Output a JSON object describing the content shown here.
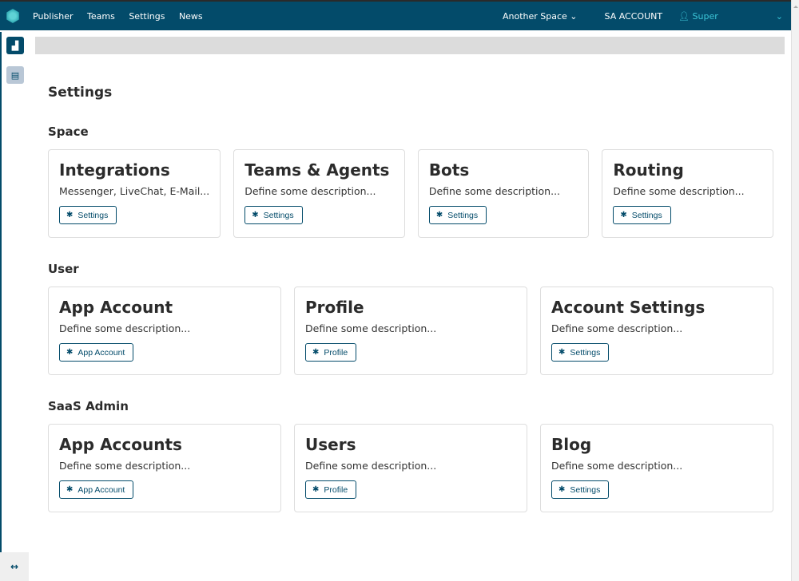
{
  "header": {
    "nav": [
      "Publisher",
      "Teams",
      "Settings",
      "News"
    ],
    "space": "Another Space",
    "account": "SA ACCOUNT",
    "user": "Super"
  },
  "page_title": "Settings",
  "sections": [
    {
      "title": "Space",
      "cards": [
        {
          "title": "Integrations",
          "desc": "Messenger, LiveChat, E-Mail...",
          "button": "Settings"
        },
        {
          "title": "Teams & Agents",
          "desc": "Define some description...",
          "button": "Settings"
        },
        {
          "title": "Bots",
          "desc": "Define some description...",
          "button": "Settings"
        },
        {
          "title": "Routing",
          "desc": "Define some description...",
          "button": "Settings"
        }
      ]
    },
    {
      "title": "User",
      "cards": [
        {
          "title": "App Account",
          "desc": "Define some description...",
          "button": "App Account"
        },
        {
          "title": "Profile",
          "desc": "Define some description...",
          "button": "Profile"
        },
        {
          "title": "Account Settings",
          "desc": "Define some description...",
          "button": "Settings"
        }
      ]
    },
    {
      "title": "SaaS Admin",
      "cards": [
        {
          "title": "App Accounts",
          "desc": "Define some description...",
          "button": "App Account"
        },
        {
          "title": "Users",
          "desc": "Define some description...",
          "button": "Profile"
        },
        {
          "title": "Blog",
          "desc": "Define some description...",
          "button": "Settings"
        }
      ]
    }
  ]
}
